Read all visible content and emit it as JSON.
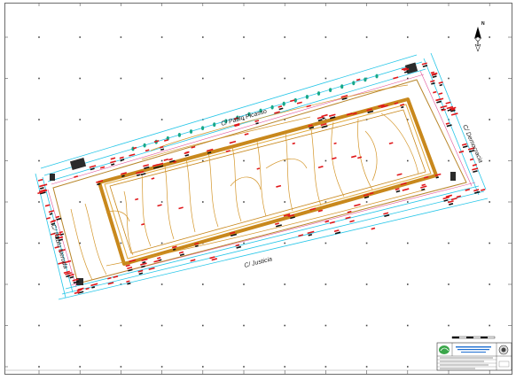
{
  "map": {
    "streets": {
      "picasso": "C/ Pablo Picasso",
      "democracia": "C/ Democracia",
      "justicia": "C/ Justicia",
      "neruda": "C/ Pablo Neruda"
    },
    "north_label": "N",
    "colors": {
      "frame": "#6b6b6b",
      "contour_major": "#c8881c",
      "contour_minor": "#e0a83a",
      "boundary": "#b8862a",
      "road_edge": "#26c6e8",
      "road_offset": "#e0569a",
      "tree": "#17a889",
      "label_red": "#e0171a",
      "label_black": "#111111",
      "hatch": "#2b2b2b"
    },
    "title_block": {
      "logo_icon": "green-logo-icon",
      "seal_icon": "seal-icon"
    }
  }
}
